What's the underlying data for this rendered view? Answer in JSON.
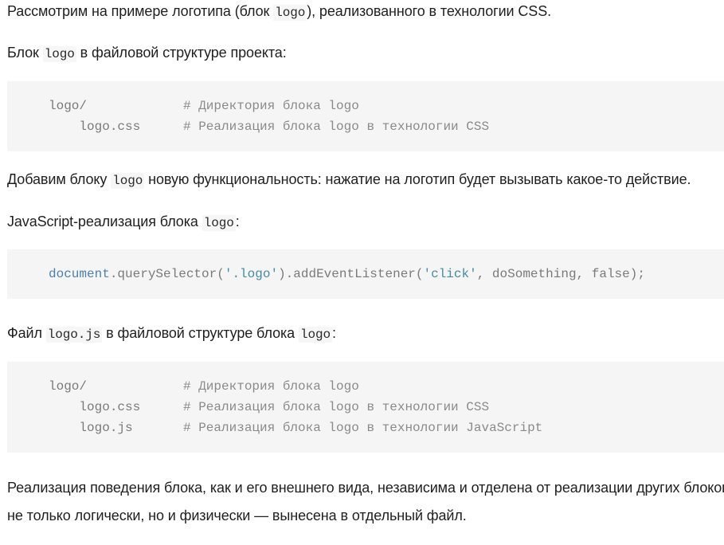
{
  "paragraphs": {
    "p1": {
      "before": "Рассмотрим на примере логотипа (блок ",
      "code": "logo",
      "after": "), реализованного в технологии CSS."
    },
    "p2": {
      "before": "Блок ",
      "code": "logo",
      "after": " в файловой структуре проекта:"
    },
    "p3": {
      "before": "Добавим блоку ",
      "code": "logo",
      "after": " новую функциональность: нажатие на логотип будет вызывать какое-то действие."
    },
    "p4": {
      "before": "JavaScript-реализация блока ",
      "code": "logo",
      "after": ":"
    },
    "p5": {
      "before": "Файл ",
      "code": "logo.js",
      "middle": " в файловой структуре блока ",
      "code2": "logo",
      "after": ":"
    },
    "p6": {
      "line1": "Реализация поведения блока, как и его внешнего вида, независима и отделена от реализации других блоков",
      "line2": "не только логически, но и физически — вынесена в отдельный файл."
    }
  },
  "code_blocks": {
    "tree1": [
      {
        "path": "logo/",
        "comment": "# Директория блока logo"
      },
      {
        "path": "    logo.css",
        "comment": "# Реализация блока logo в технологии CSS"
      }
    ],
    "js": {
      "obj": "document",
      "method": ".querySelector(",
      "arg1": "'.logo'",
      "mid": ").addEventListener(",
      "arg2": "'click'",
      "rest": ", doSomething, false);"
    },
    "tree2": [
      {
        "path": "logo/",
        "comment": "# Директория блока logo"
      },
      {
        "path": "    logo.css",
        "comment": "# Реализация блока logo в технологии CSS"
      },
      {
        "path": "    logo.js",
        "comment": "# Реализация блока logo в технологии JavaScript"
      }
    ]
  },
  "colors": {
    "code_bg": "#f5f5f5",
    "comment": "#8a8a8a",
    "keyword": "#4e7fa8",
    "string": "#4a8aa0",
    "text": "#1f1f1f"
  }
}
